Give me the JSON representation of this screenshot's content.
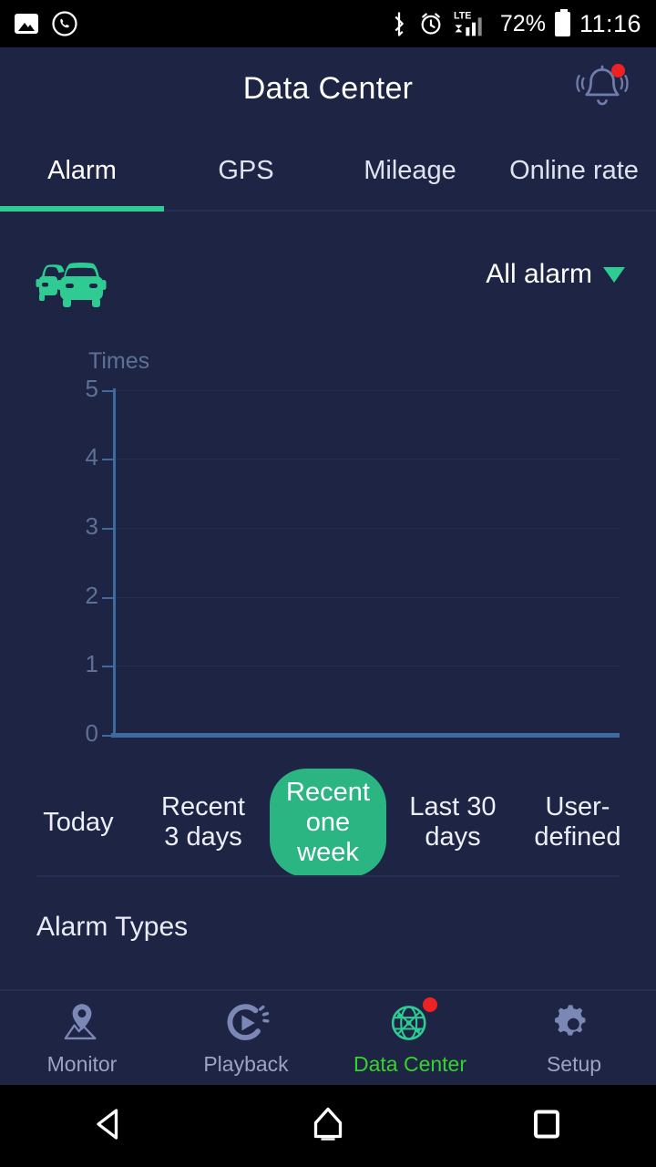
{
  "statusbar": {
    "icons": [
      "image-icon",
      "whatsapp-icon",
      "bluetooth-icon",
      "alarm-clock-icon",
      "lte-signal-icon"
    ],
    "battery_percent": "72%",
    "time": "11:16",
    "network": "LTE"
  },
  "header": {
    "title": "Data Center",
    "notification_icon": "bell-icon",
    "has_badge": true
  },
  "tabs": [
    {
      "label": "Alarm",
      "active": true
    },
    {
      "label": "GPS",
      "active": false
    },
    {
      "label": "Mileage",
      "active": false
    },
    {
      "label": "Online rate",
      "active": false
    }
  ],
  "alarm_panel": {
    "vehicle_icon": "two-cars-icon",
    "filter": {
      "label": "All alarm",
      "caret": "chevron-down-icon"
    }
  },
  "chart_data": {
    "type": "bar",
    "title": "",
    "ylabel": "Times",
    "xlabel": "",
    "categories": [],
    "values": [],
    "yticks": [
      "0",
      "1",
      "2",
      "3",
      "4",
      "5"
    ],
    "ylim": [
      0,
      5
    ],
    "grid": true,
    "legend": "none",
    "note": "no data plotted - empty chart"
  },
  "ranges": [
    {
      "label": "Today",
      "selected": false
    },
    {
      "label": "Recent 3 days",
      "selected": false
    },
    {
      "label": "Recent one week",
      "selected": true
    },
    {
      "label": "Last 30 days",
      "selected": false
    },
    {
      "label": "User-defined",
      "selected": false
    }
  ],
  "sections": {
    "alarm_types_title": "Alarm Types"
  },
  "bottomnav": [
    {
      "label": "Monitor",
      "icon": "map-pin-icon",
      "active": false,
      "badge": false
    },
    {
      "label": "Playback",
      "icon": "play-circle-icon",
      "active": false,
      "badge": false
    },
    {
      "label": "Data Center",
      "icon": "globe-network-icon",
      "active": true,
      "badge": true
    },
    {
      "label": "Setup",
      "icon": "gear-icon",
      "active": false,
      "badge": false
    }
  ],
  "androidnav": [
    {
      "name": "back-button",
      "icon": "triangle-left-icon"
    },
    {
      "name": "home-button",
      "icon": "home-icon"
    },
    {
      "name": "recents-button",
      "icon": "square-icon"
    }
  ],
  "colors": {
    "background": "#1e2444",
    "accent_green": "#2ecc93",
    "active_green": "#36d22e",
    "axis_blue": "#3f6a9e",
    "badge_red": "#ee2222"
  }
}
